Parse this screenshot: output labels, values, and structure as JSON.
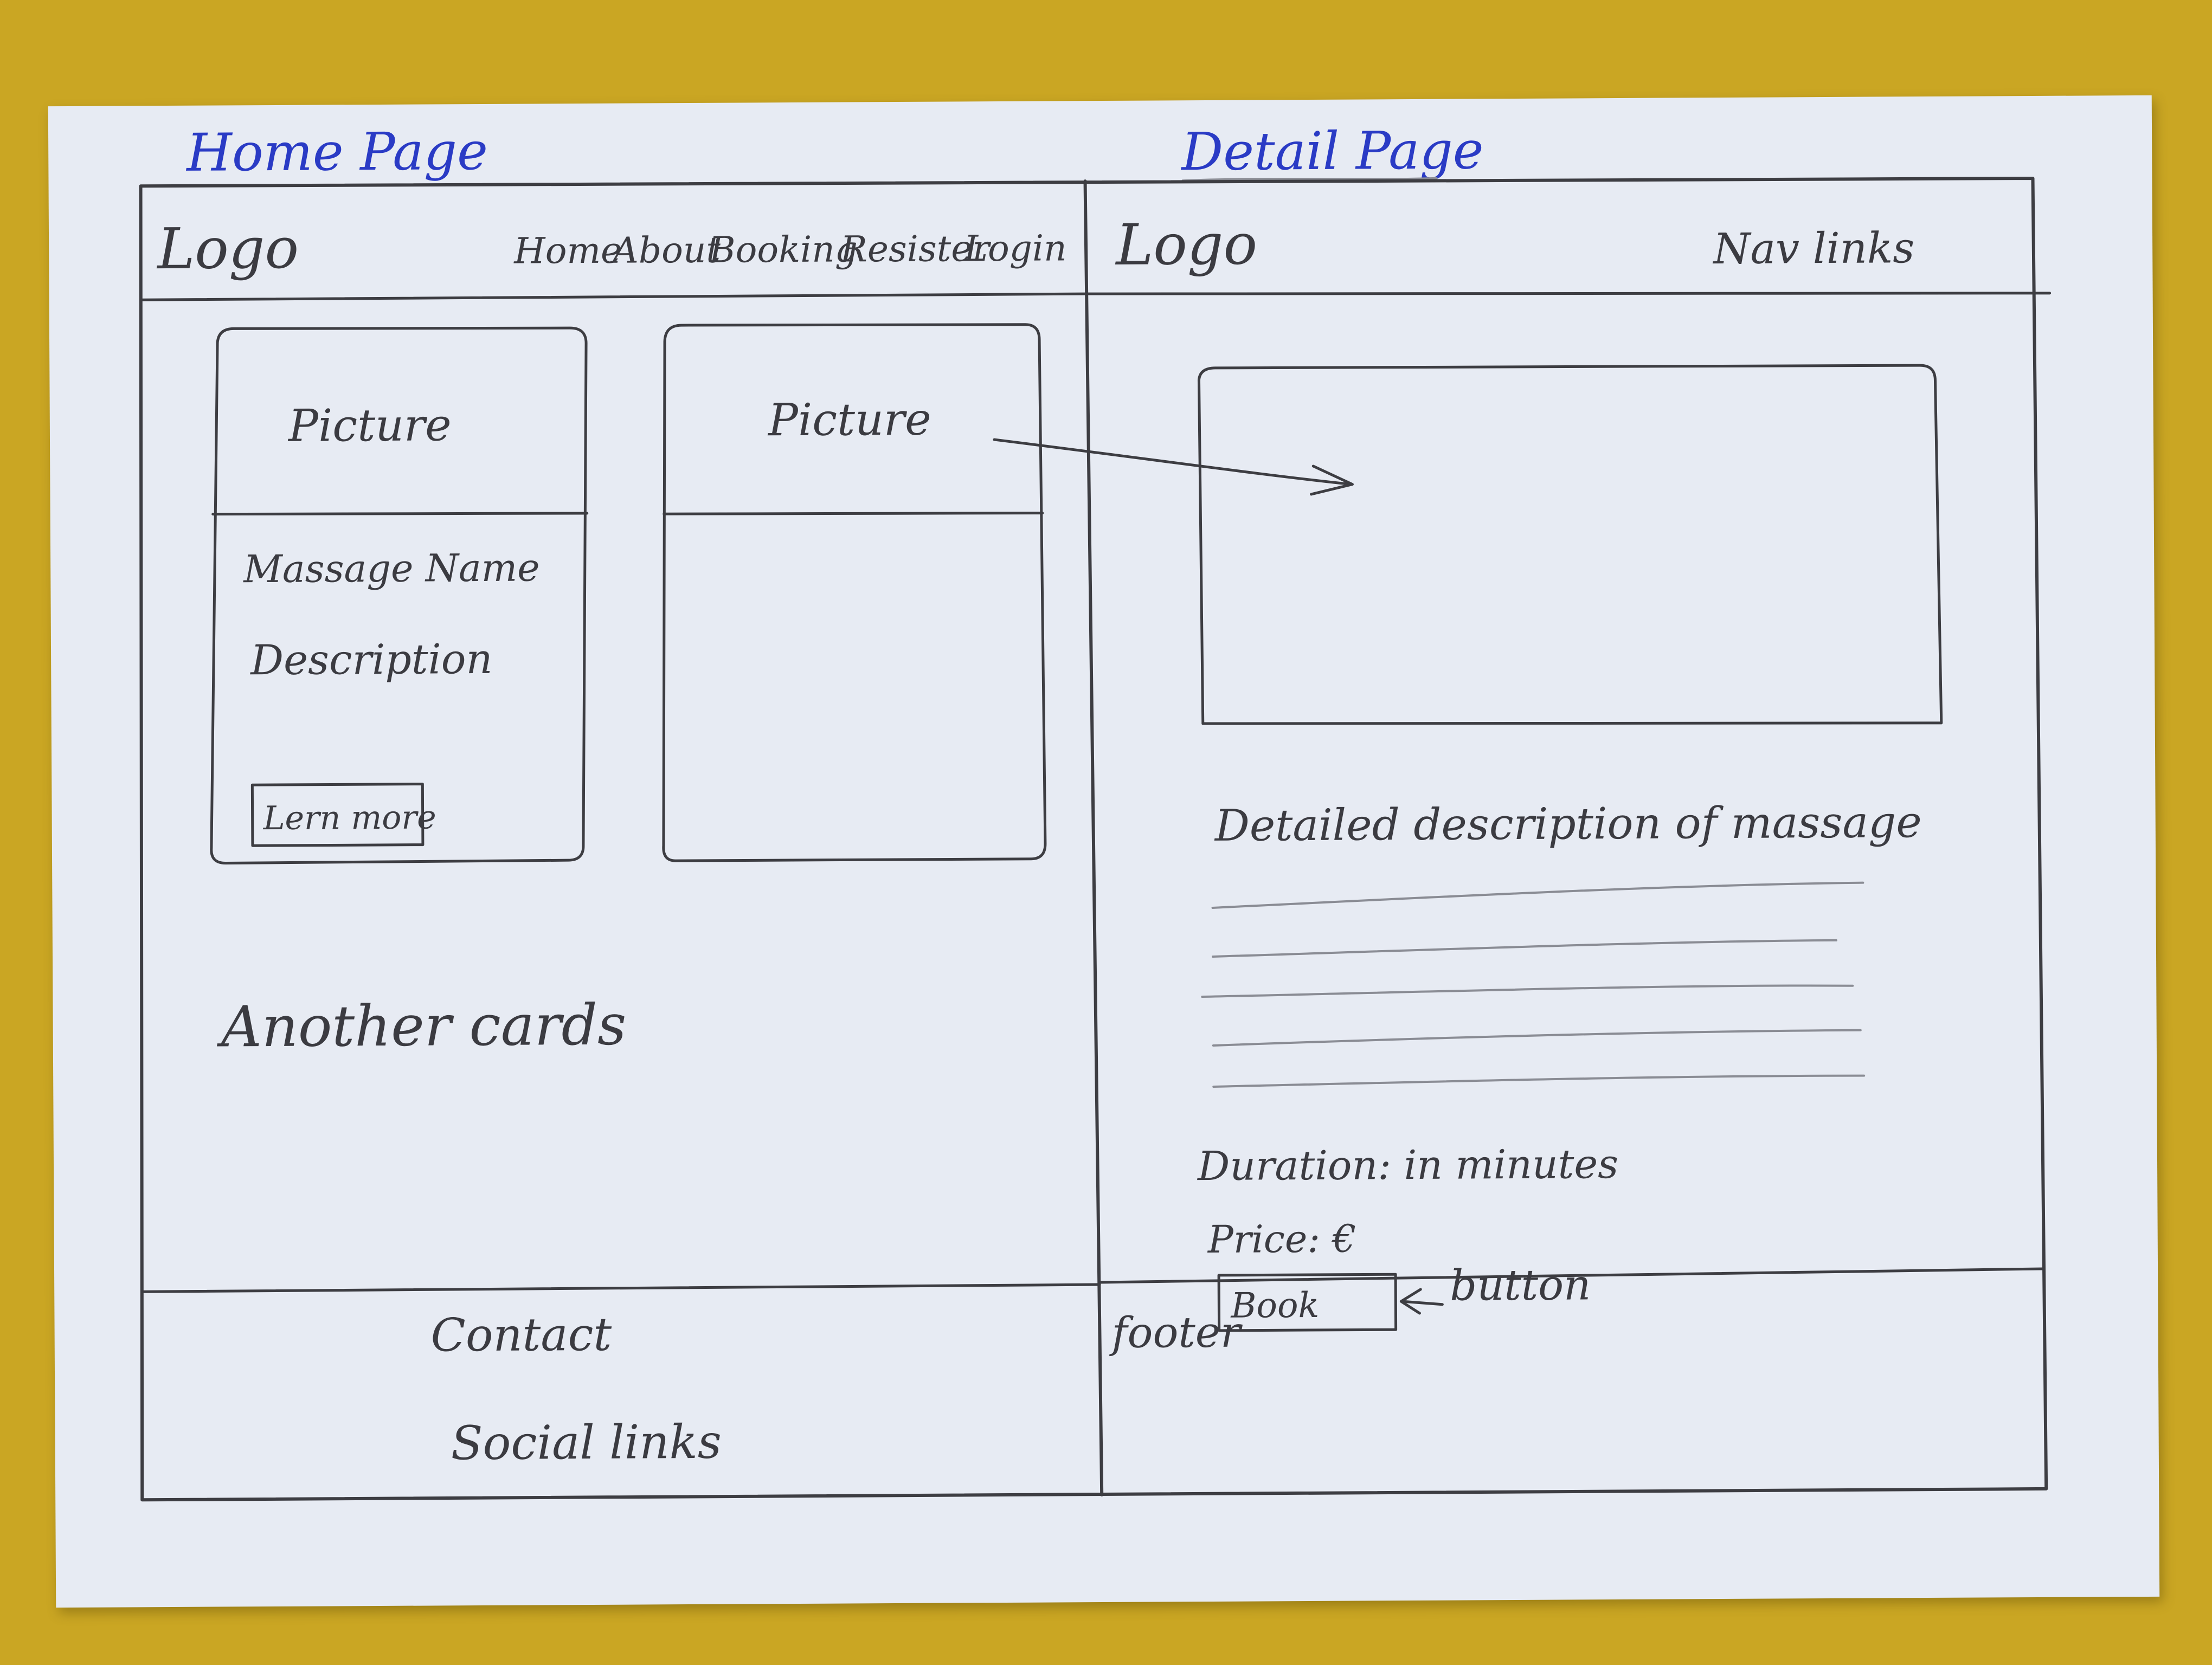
{
  "home_page": {
    "heading": "Home Page",
    "logo": "Logo",
    "nav": [
      "Home",
      "About",
      "Booking",
      "Resister",
      "Login"
    ],
    "cards": [
      {
        "picture": "Picture",
        "name": "Massage Name",
        "description": "Description",
        "button": "Lern more"
      },
      {
        "picture": "Picture"
      }
    ],
    "more": "Another cards",
    "footer": {
      "contact": "Contact",
      "social": "Social links"
    }
  },
  "detail_page": {
    "heading": "Detail Page",
    "logo": "Logo",
    "nav": "Nav links",
    "description": "Detailed description of massage",
    "duration": "Duration: in minutes",
    "price": "Price: €",
    "book_button": "Book",
    "button_annotation": "button",
    "footer": "footer"
  },
  "colors": {
    "paper": "#e7ebf3",
    "background": "#caa623",
    "pencil": "#3b3b41",
    "blue_pen": "#2a3bc5"
  }
}
